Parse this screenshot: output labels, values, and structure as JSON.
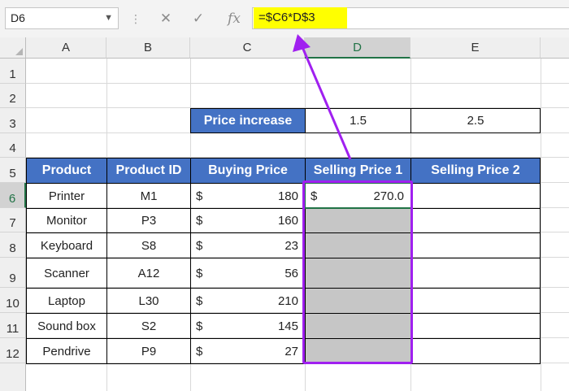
{
  "formula_bar": {
    "name_box": "D6",
    "cancel_icon": "✕",
    "enter_icon": "✓",
    "fx_icon": "fx",
    "formula": "=$C6*D$3"
  },
  "columns": [
    "A",
    "B",
    "C",
    "D",
    "E"
  ],
  "rows": [
    "1",
    "2",
    "3",
    "4",
    "5",
    "6",
    "7",
    "8",
    "9",
    "10",
    "11",
    "12"
  ],
  "price_increase": {
    "label": "Price increase",
    "value_1": "1.5",
    "value_2": "2.5"
  },
  "table": {
    "headers": [
      "Product",
      "Product ID",
      "Buying Price",
      "Selling Price 1",
      "Selling Price 2"
    ],
    "currency_symbol": "$",
    "rows": [
      {
        "product": "Printer",
        "id": "M1",
        "buying": "180",
        "selling1": "270.0",
        "selling2": ""
      },
      {
        "product": "Monitor",
        "id": "P3",
        "buying": "160",
        "selling1": "",
        "selling2": ""
      },
      {
        "product": "Keyboard",
        "id": "S8",
        "buying": "23",
        "selling1": "",
        "selling2": ""
      },
      {
        "product": "Scanner",
        "id": "A12",
        "buying": "56",
        "selling1": "",
        "selling2": ""
      },
      {
        "product": "Laptop",
        "id": "L30",
        "buying": "210",
        "selling1": "",
        "selling2": ""
      },
      {
        "product": "Sound box",
        "id": "S2",
        "buying": "145",
        "selling1": "",
        "selling2": ""
      },
      {
        "product": "Pendrive",
        "id": "P9",
        "buying": "27",
        "selling1": "",
        "selling2": ""
      }
    ]
  },
  "colors": {
    "header_fill": "#4472c4",
    "highlight_fill": "#ffff00",
    "annotation": "#a020f0",
    "empty_fill": "#c6c6c6"
  }
}
